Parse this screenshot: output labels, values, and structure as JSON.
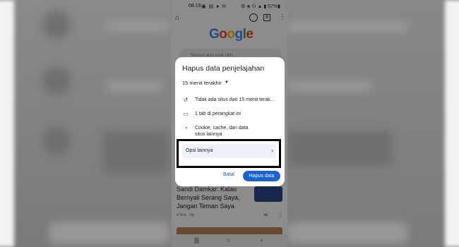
{
  "status_bar": {
    "time": "08.19",
    "icons": "▣ ▤ ● ✉",
    "right": "⚙ ◈ ⊙ ▲ ▮ 57%▮"
  },
  "toolbar": {
    "home_icon": "⌂",
    "tab_count": "8",
    "menu_icon": "⋮"
  },
  "google": {
    "g1": "G",
    "o1": "o",
    "o2": "o",
    "g2": "g",
    "l": "l",
    "e": "e"
  },
  "search": {
    "placeholder": "Telusuri atau ketik URL"
  },
  "dialog": {
    "title": "Hapus data penjelajahan",
    "time_range": "15 menit terakhir",
    "items": [
      {
        "icon": "history-icon",
        "glyph": "↺",
        "label": "Tidak ada situs dari 15 menit terak..."
      },
      {
        "icon": "tab-icon",
        "glyph": "▭",
        "label": "1 tab di perangkat ini"
      },
      {
        "icon": "cookie-icon",
        "glyph": "◔",
        "label": "Cookie, cache, dan data situs lainnya"
      }
    ],
    "more_options": "Opsi lainnya",
    "cancel": "Batal",
    "confirm": "Hapus data"
  },
  "article": {
    "title": "Sandi Damkar: Kalau Bernyali Serang Saya, Jangan Teman Saya",
    "meta": "▾ Viva · 20j",
    "share_icon": "share-icon"
  },
  "navbar": {
    "recents": "|||",
    "home": "○",
    "back": "‹"
  },
  "colors": {
    "accent": "#1a62d0",
    "highlight_box": "#000000",
    "more_options_bg": "#eef2f8"
  }
}
